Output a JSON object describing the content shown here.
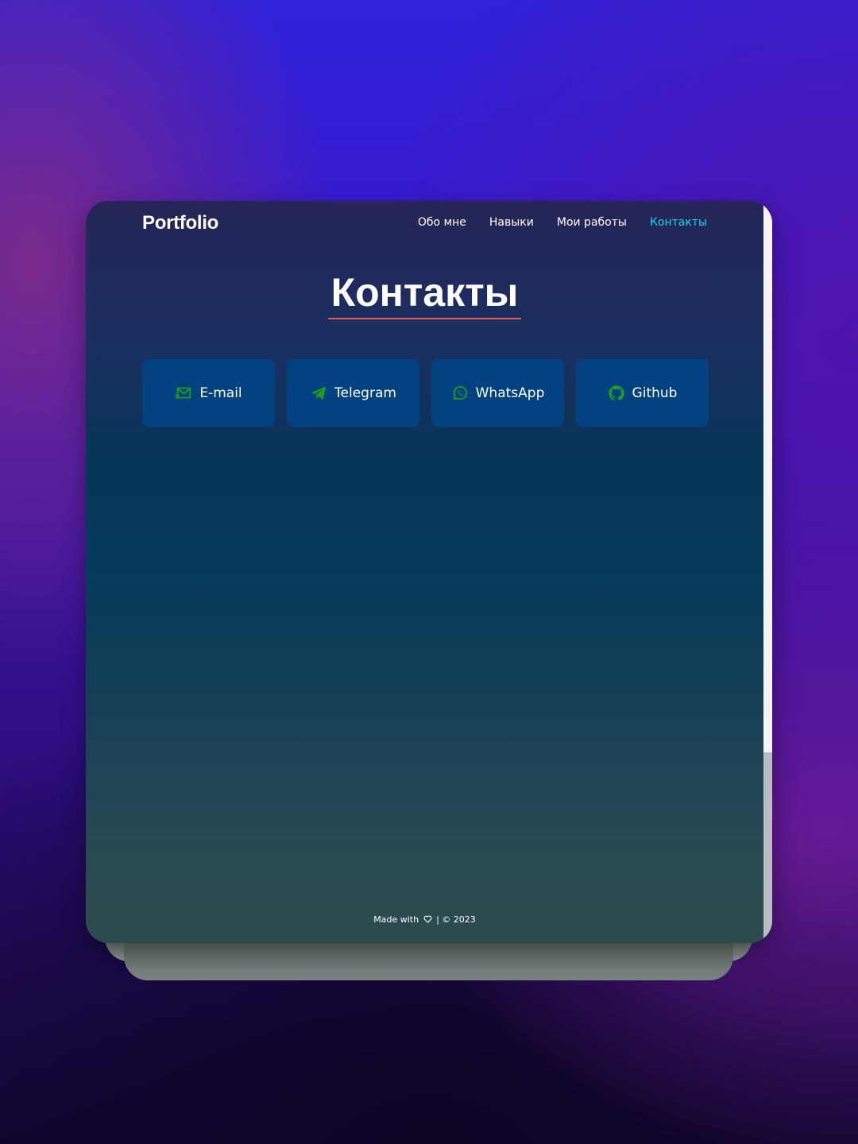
{
  "header": {
    "logo": "Portfolio",
    "nav": [
      {
        "label": "Обо мне",
        "active": false
      },
      {
        "label": "Навыки",
        "active": false
      },
      {
        "label": "Мои работы",
        "active": false
      },
      {
        "label": "Контакты",
        "active": true
      }
    ]
  },
  "main": {
    "title": "Контакты",
    "contacts": [
      {
        "label": "E-mail",
        "icon": "email-icon"
      },
      {
        "label": "Telegram",
        "icon": "telegram-icon"
      },
      {
        "label": "WhatsApp",
        "icon": "whatsapp-icon"
      },
      {
        "label": "Github",
        "icon": "github-icon"
      }
    ]
  },
  "footer": {
    "made_with": "Made with",
    "rest": "| © 2023"
  },
  "colors": {
    "accent": "#16d4ee",
    "underline": "#e25b56",
    "button_bg": "#034280",
    "icon_green": "#1ea01e"
  }
}
